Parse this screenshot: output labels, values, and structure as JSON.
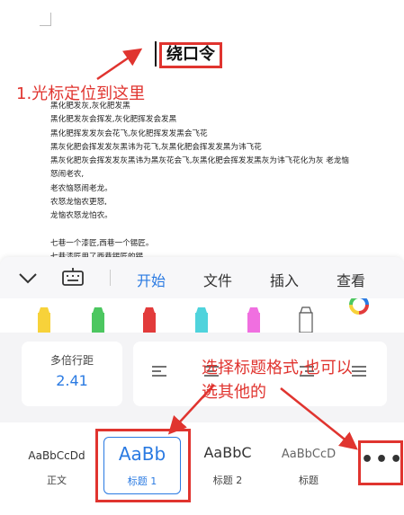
{
  "document": {
    "title": "绕口令",
    "poem_lines": [
      "黑化肥发灰,灰化肥发黑",
      "黑化肥发灰会挥发,灰化肥挥发会发黑",
      "黑化肥挥发发灰会花飞,灰化肥挥发发黑会飞花",
      "黑灰化肥会挥发发灰黑讳为花飞,灰黑化肥会挥发发黑为讳飞花",
      "黑灰化肥灰会挥发发灰黑讳为黑灰花会飞,灰黑化肥会挥发发黑灰为讳飞花化为灰   老龙恼",
      "怒闹老农,",
      "老农恼怒闹老龙。",
      "农怒龙恼农更怒,",
      "龙恼农怒龙怕农。",
      "",
      "七巷一个漆匠,西巷一个锡匠。",
      "七巷漆匠用了西巷锡匠的锡。"
    ]
  },
  "annotations": {
    "step1": "1.光标定位到这里",
    "step2_line1": "选择标题格式,也可以",
    "step2_line2": "选其他的"
  },
  "toolbar": {
    "tabs": [
      {
        "label": "开始",
        "active": true
      },
      {
        "label": "文件",
        "active": false
      },
      {
        "label": "插入",
        "active": false
      },
      {
        "label": "查看",
        "active": false
      }
    ],
    "collapse_icon": "chevron-down-icon",
    "keyboard_icon": "keyboard-icon"
  },
  "highlighters": {
    "colors": [
      "#f7d23a",
      "#4cc760",
      "#e23b3b",
      "#4fd3dc",
      "#f06fe0",
      "#ffffff"
    ],
    "color_wheel_icon": "color-wheel-icon"
  },
  "paragraph": {
    "spacing_label": "多倍行距",
    "spacing_value": "2.41"
  },
  "styles": {
    "items": [
      {
        "sample": "AaBbCcDd",
        "name": "正文"
      },
      {
        "sample": "AaBb",
        "name": "标题 1"
      },
      {
        "sample": "AaBbC",
        "name": "标题 2"
      },
      {
        "sample": "AaBbCcD",
        "name": "标题"
      }
    ],
    "more_label": "•••"
  },
  "colors": {
    "accent": "#2a7ae2",
    "annotation_red": "#e0342f"
  }
}
